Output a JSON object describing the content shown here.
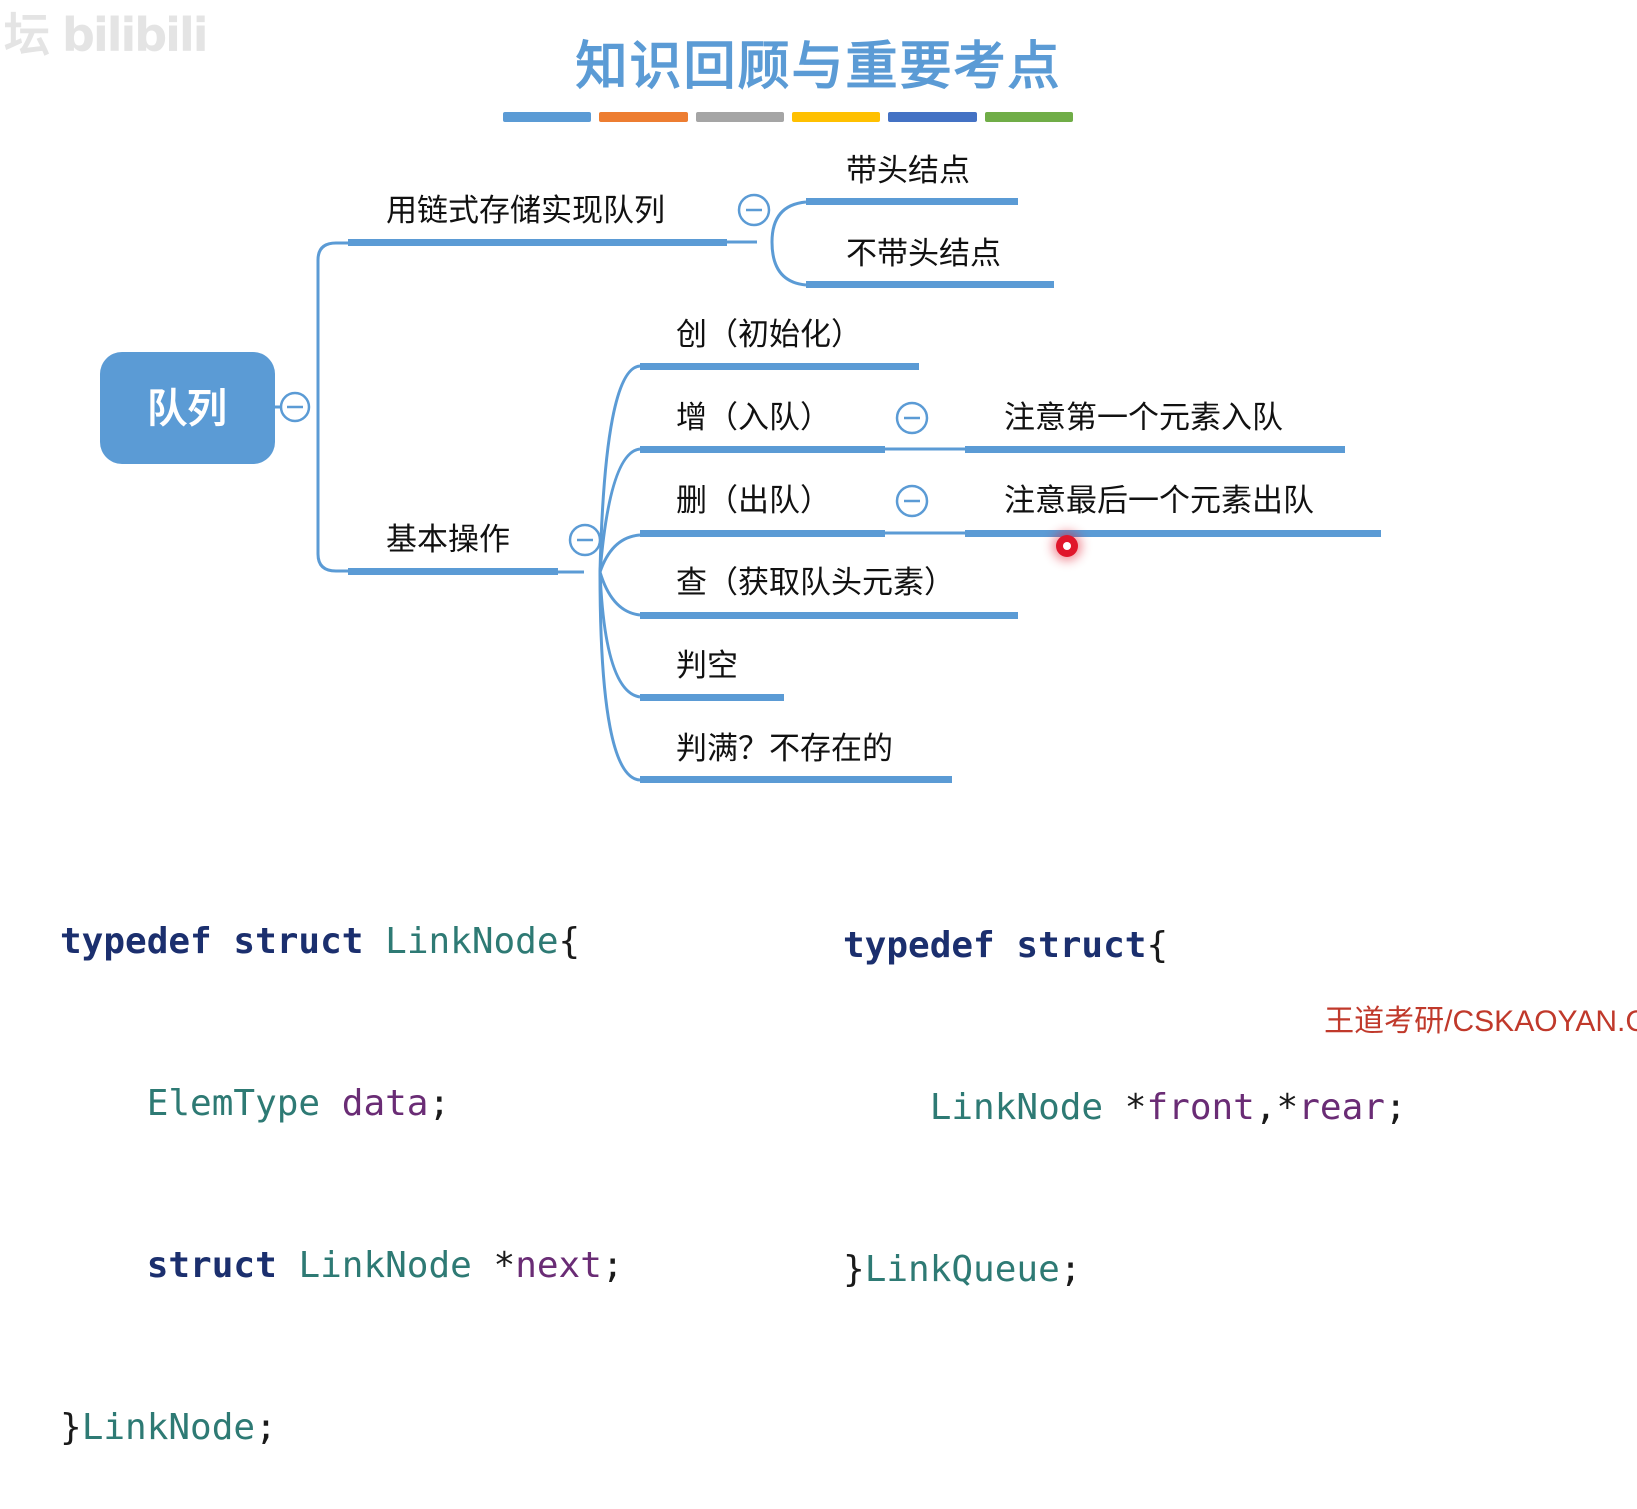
{
  "watermark": "坛 bilibili",
  "title": "知识回顾与重要考点",
  "title_bar_colors": [
    "#5b9bd5",
    "#ed7d31",
    "#a5a5a5",
    "#ffc000",
    "#4472c4",
    "#70ad47"
  ],
  "mindmap": {
    "root": "队列",
    "branches": {
      "chain": {
        "label": "用链式存储实现队列",
        "children": [
          "带头结点",
          "不带头结点"
        ]
      },
      "ops": {
        "label": "基本操作",
        "create": "创（初始化）",
        "enqueue": "增（入队）",
        "enqueue_note": "注意第一个元素入队",
        "dequeue": "删（出队）",
        "dequeue_note": "注意最后一个元素出队",
        "peek": "查（获取队头元素）",
        "empty": "判空",
        "full": "判满？不存在的"
      }
    },
    "line_color": "#5b9bd5"
  },
  "code_left": {
    "l1_kw1": "typedef",
    "l1_kw2": "struct",
    "l1_type": "LinkNode",
    "l1_brace": "{",
    "l2_type": "ElemType",
    "l2_field": "data",
    "l2_semi": ";",
    "l3_kw": "struct",
    "l3_type": "LinkNode",
    "l3_ptr": "*",
    "l3_field": "next",
    "l3_semi": ";",
    "l4_brace": "}",
    "l4_name": "LinkNode",
    "l4_semi": ";"
  },
  "code_right": {
    "l1_kw1": "typedef",
    "l1_kw2": "struct",
    "l1_brace": "{",
    "l2_type": "LinkNode",
    "l2_ptr1": "*",
    "l2_field1": "front",
    "l2_comma": ",",
    "l2_ptr2": "*",
    "l2_field2": "rear",
    "l2_semi": ";",
    "l3_brace": "}",
    "l3_name": "LinkQueue",
    "l3_semi": ";"
  },
  "footer_brand": "王道考研/CSKAOYAN.C"
}
